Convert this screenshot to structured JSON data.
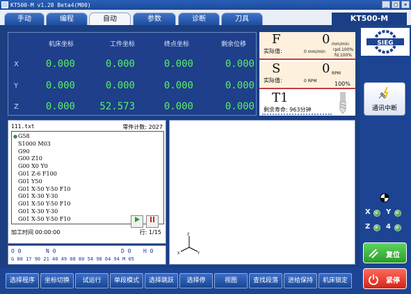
{
  "window": {
    "title": "KT500-M v1.28 Beta4(M00)"
  },
  "tabs": [
    {
      "label": "手动"
    },
    {
      "label": "编程"
    },
    {
      "label": "自动"
    },
    {
      "label": "参数"
    },
    {
      "label": "诊断"
    },
    {
      "label": "刀具"
    }
  ],
  "model": "KT500-M",
  "coords": {
    "headers": [
      "机床坐标",
      "工件坐标",
      "终点坐标",
      "剩余位移"
    ],
    "rows": [
      {
        "axis": "X",
        "values": [
          "0.000",
          "0.000",
          "0.000",
          "0.000"
        ]
      },
      {
        "axis": "Y",
        "values": [
          "0.000",
          "0.000",
          "0.000",
          "0.000"
        ]
      },
      {
        "axis": "Z",
        "values": [
          "0.000",
          "52.573",
          "0.000",
          "0.000"
        ]
      }
    ]
  },
  "feed": {
    "letter": "F",
    "value": "0",
    "unit": "mm/min",
    "actual_label": "实际值:",
    "actual_value": "0 mm/min",
    "rpd": "rpd.100%",
    "fd": "fd.100%"
  },
  "spindle": {
    "letter": "S",
    "value": "0",
    "unit": "RPM",
    "actual_label": "实际值:",
    "actual_value": "0 RPM",
    "ratio": "100%"
  },
  "tool": {
    "name": "T1",
    "life_label": "剩余寿命: 963分钟"
  },
  "program": {
    "file": "111.txt",
    "count_label": "零件计数: 2027",
    "lines": [
      "G58",
      "S1000 M03",
      "G90",
      "G00 Z10",
      "G00 X0 Y0",
      "G01 Z-6 F100",
      "G01 Y50",
      "G01 X-50 Y-50 F10",
      "G01 X-30 Y-30",
      "G01 X-50 Y-50 F10",
      "G01 X-30 Y-30",
      "G01 X-50 Y-50 F10",
      "G01 X-30 Y-30"
    ],
    "time_label": "加工时间 00:00:00",
    "line_label": "行: 1/15"
  },
  "gcodes": {
    "o": "0",
    "n": "0",
    "d": "0",
    "h": "0",
    "row2": "G 00 17 90 21 40 49 08 80 54 98 64 94  M 05"
  },
  "right_panel": {
    "comm_label": "通讯中断",
    "axes": [
      {
        "name": "X"
      },
      {
        "name": "Y"
      },
      {
        "name": "Z"
      },
      {
        "name": "4"
      }
    ],
    "reset_label": "复位",
    "estop_label": "紧停"
  },
  "softkeys": [
    "选择程序",
    "坐标切换",
    "试运行",
    "单段模式",
    "选择跳跃",
    "选择停",
    "视图",
    "查找段落",
    "进给保持",
    "机床锁定"
  ],
  "colors": {
    "accent_blue": "#1c4493",
    "value_green": "#58f068",
    "reset_green": "#2a9c2a",
    "estop_red": "#d02418"
  },
  "icons": {
    "comm": "plug-lightning-icon",
    "reset": "reset-arrows-icon",
    "estop": "power-icon",
    "logo": "sieg-logo",
    "axes": "xyz-axes-icon"
  }
}
